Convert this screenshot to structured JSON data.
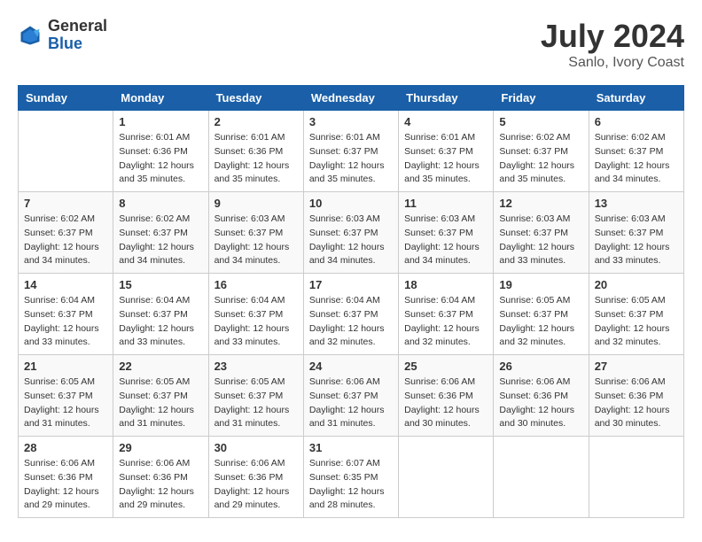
{
  "header": {
    "logo": {
      "line1": "General",
      "line2": "Blue"
    },
    "title": "July 2024",
    "location": "Sanlo, Ivory Coast"
  },
  "days_of_week": [
    "Sunday",
    "Monday",
    "Tuesday",
    "Wednesday",
    "Thursday",
    "Friday",
    "Saturday"
  ],
  "weeks": [
    [
      {
        "day": "",
        "info": ""
      },
      {
        "day": "1",
        "info": "Sunrise: 6:01 AM\nSunset: 6:36 PM\nDaylight: 12 hours\nand 35 minutes."
      },
      {
        "day": "2",
        "info": "Sunrise: 6:01 AM\nSunset: 6:36 PM\nDaylight: 12 hours\nand 35 minutes."
      },
      {
        "day": "3",
        "info": "Sunrise: 6:01 AM\nSunset: 6:37 PM\nDaylight: 12 hours\nand 35 minutes."
      },
      {
        "day": "4",
        "info": "Sunrise: 6:01 AM\nSunset: 6:37 PM\nDaylight: 12 hours\nand 35 minutes."
      },
      {
        "day": "5",
        "info": "Sunrise: 6:02 AM\nSunset: 6:37 PM\nDaylight: 12 hours\nand 35 minutes."
      },
      {
        "day": "6",
        "info": "Sunrise: 6:02 AM\nSunset: 6:37 PM\nDaylight: 12 hours\nand 34 minutes."
      }
    ],
    [
      {
        "day": "7",
        "info": "Sunrise: 6:02 AM\nSunset: 6:37 PM\nDaylight: 12 hours\nand 34 minutes."
      },
      {
        "day": "8",
        "info": "Sunrise: 6:02 AM\nSunset: 6:37 PM\nDaylight: 12 hours\nand 34 minutes."
      },
      {
        "day": "9",
        "info": "Sunrise: 6:03 AM\nSunset: 6:37 PM\nDaylight: 12 hours\nand 34 minutes."
      },
      {
        "day": "10",
        "info": "Sunrise: 6:03 AM\nSunset: 6:37 PM\nDaylight: 12 hours\nand 34 minutes."
      },
      {
        "day": "11",
        "info": "Sunrise: 6:03 AM\nSunset: 6:37 PM\nDaylight: 12 hours\nand 34 minutes."
      },
      {
        "day": "12",
        "info": "Sunrise: 6:03 AM\nSunset: 6:37 PM\nDaylight: 12 hours\nand 33 minutes."
      },
      {
        "day": "13",
        "info": "Sunrise: 6:03 AM\nSunset: 6:37 PM\nDaylight: 12 hours\nand 33 minutes."
      }
    ],
    [
      {
        "day": "14",
        "info": "Sunrise: 6:04 AM\nSunset: 6:37 PM\nDaylight: 12 hours\nand 33 minutes."
      },
      {
        "day": "15",
        "info": "Sunrise: 6:04 AM\nSunset: 6:37 PM\nDaylight: 12 hours\nand 33 minutes."
      },
      {
        "day": "16",
        "info": "Sunrise: 6:04 AM\nSunset: 6:37 PM\nDaylight: 12 hours\nand 33 minutes."
      },
      {
        "day": "17",
        "info": "Sunrise: 6:04 AM\nSunset: 6:37 PM\nDaylight: 12 hours\nand 32 minutes."
      },
      {
        "day": "18",
        "info": "Sunrise: 6:04 AM\nSunset: 6:37 PM\nDaylight: 12 hours\nand 32 minutes."
      },
      {
        "day": "19",
        "info": "Sunrise: 6:05 AM\nSunset: 6:37 PM\nDaylight: 12 hours\nand 32 minutes."
      },
      {
        "day": "20",
        "info": "Sunrise: 6:05 AM\nSunset: 6:37 PM\nDaylight: 12 hours\nand 32 minutes."
      }
    ],
    [
      {
        "day": "21",
        "info": "Sunrise: 6:05 AM\nSunset: 6:37 PM\nDaylight: 12 hours\nand 31 minutes."
      },
      {
        "day": "22",
        "info": "Sunrise: 6:05 AM\nSunset: 6:37 PM\nDaylight: 12 hours\nand 31 minutes."
      },
      {
        "day": "23",
        "info": "Sunrise: 6:05 AM\nSunset: 6:37 PM\nDaylight: 12 hours\nand 31 minutes."
      },
      {
        "day": "24",
        "info": "Sunrise: 6:06 AM\nSunset: 6:37 PM\nDaylight: 12 hours\nand 31 minutes."
      },
      {
        "day": "25",
        "info": "Sunrise: 6:06 AM\nSunset: 6:36 PM\nDaylight: 12 hours\nand 30 minutes."
      },
      {
        "day": "26",
        "info": "Sunrise: 6:06 AM\nSunset: 6:36 PM\nDaylight: 12 hours\nand 30 minutes."
      },
      {
        "day": "27",
        "info": "Sunrise: 6:06 AM\nSunset: 6:36 PM\nDaylight: 12 hours\nand 30 minutes."
      }
    ],
    [
      {
        "day": "28",
        "info": "Sunrise: 6:06 AM\nSunset: 6:36 PM\nDaylight: 12 hours\nand 29 minutes."
      },
      {
        "day": "29",
        "info": "Sunrise: 6:06 AM\nSunset: 6:36 PM\nDaylight: 12 hours\nand 29 minutes."
      },
      {
        "day": "30",
        "info": "Sunrise: 6:06 AM\nSunset: 6:36 PM\nDaylight: 12 hours\nand 29 minutes."
      },
      {
        "day": "31",
        "info": "Sunrise: 6:07 AM\nSunset: 6:35 PM\nDaylight: 12 hours\nand 28 minutes."
      },
      {
        "day": "",
        "info": ""
      },
      {
        "day": "",
        "info": ""
      },
      {
        "day": "",
        "info": ""
      }
    ]
  ]
}
